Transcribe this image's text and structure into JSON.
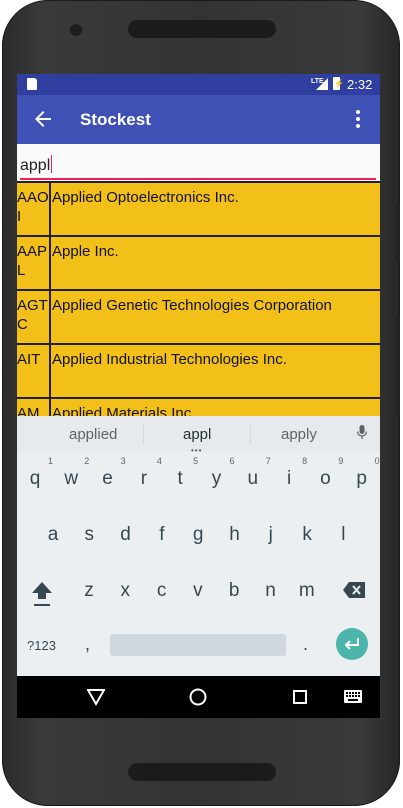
{
  "status_bar": {
    "network": "LTE",
    "time": "2:32"
  },
  "app_bar": {
    "title": "Stockest"
  },
  "search": {
    "value": "appl"
  },
  "results": [
    {
      "symbol": "AAOI",
      "name": "Applied Optoelectronics Inc."
    },
    {
      "symbol": "AAPL",
      "name": "Apple Inc."
    },
    {
      "symbol": "AGTC",
      "name": "Applied Genetic Technologies Corporation"
    },
    {
      "symbol": "AIT",
      "name": "Applied Industrial Technologies Inc."
    },
    {
      "symbol": "AMA",
      "name": "Applied Materials Inc."
    }
  ],
  "keyboard": {
    "suggestions": [
      "applied",
      "appl",
      "apply"
    ],
    "row1": [
      [
        "q",
        "1"
      ],
      [
        "w",
        "2"
      ],
      [
        "e",
        "3"
      ],
      [
        "r",
        "4"
      ],
      [
        "t",
        "5"
      ],
      [
        "y",
        "6"
      ],
      [
        "u",
        "7"
      ],
      [
        "i",
        "8"
      ],
      [
        "o",
        "9"
      ],
      [
        "p",
        "0"
      ]
    ],
    "row2": [
      "a",
      "s",
      "d",
      "f",
      "g",
      "h",
      "j",
      "k",
      "l"
    ],
    "row3": [
      "z",
      "x",
      "c",
      "v",
      "b",
      "n",
      "m"
    ],
    "symbols_label": "?123",
    "comma": ",",
    "period": "."
  },
  "colors": {
    "primary": "#3f51b5",
    "primary_dark": "#303f9f",
    "accent": "#e91e63",
    "row_bg": "#f2c019"
  }
}
